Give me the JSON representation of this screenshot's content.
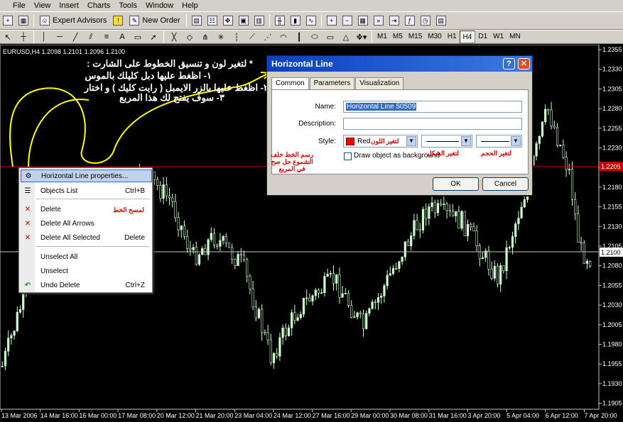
{
  "menu": [
    "File",
    "View",
    "Insert",
    "Charts",
    "Tools",
    "Window",
    "Help"
  ],
  "toolbar": {
    "expert_advisors": "Expert Advisors",
    "new_order": "New Order",
    "timeframes": [
      "M1",
      "M5",
      "M15",
      "M30",
      "H1",
      "H4",
      "D1",
      "W1",
      "MN"
    ],
    "active_timeframe": "H4"
  },
  "chart": {
    "symbol_info": "EURUSD,H4  1.2098 1.2101 1.2096 1.2100",
    "price_labels": [
      "1.2355",
      "1.2330",
      "1.2305",
      "1.2280",
      "1.2255",
      "1.2230",
      "1.2205",
      "1.2180",
      "1.2155",
      "1.2130",
      "1.2105",
      "1.2080",
      "1.2055",
      "1.2030",
      "1.2005",
      "1.1980",
      "1.1955",
      "1.1930",
      "1.1905"
    ],
    "time_labels": [
      "13 Mar 2006",
      "14 Mar 16:00",
      "16 Mar 00:00",
      "17 Mar 08:00",
      "20 Mar 12:00",
      "21 Mar 20:00",
      "23 Mar 04:00",
      "24 Mar 12:00",
      "27 Mar 16:00",
      "29 Mar 00:00",
      "30 Mar 08:00",
      "31 Mar 16:00",
      "3 Apr 20:00",
      "5 Apr 04:00",
      "6 Apr 12:00",
      "7 Apr 20:00"
    ],
    "hline_price": "1.2205",
    "current_price": "1.2100",
    "colors": {
      "hline": "#cc0000",
      "candle": "#ccffcc",
      "grid": "#c8c8c8",
      "price_box": "#cc0000"
    }
  },
  "instructions": [
    "* لتغير لون و تنسيق الخطوط على الشارت :",
    "١- اظغط عليها دبل كليلك بالموس",
    "٢- اظغط عليها بالزر الايمبل ( رايت كليك ) و اختار",
    "٣- سوف يفتح لك هذا المربع"
  ],
  "context_menu": {
    "items": [
      {
        "label": "Horizontal Line properties...",
        "shortcut": "",
        "icon": "properties-icon"
      },
      {
        "label": "Objects List",
        "shortcut": "Ctrl+B",
        "icon": "objects-list-icon"
      },
      {
        "label": "Delete",
        "shortcut": "",
        "icon": "delete-icon"
      },
      {
        "label": "Delete All Arrows",
        "shortcut": "",
        "icon": "delete-arrows-icon"
      },
      {
        "label": "Delete All Selected",
        "shortcut": "Delete",
        "icon": "delete-selected-icon"
      },
      {
        "label": "Unselect All",
        "shortcut": "",
        "icon": ""
      },
      {
        "label": "Unselect",
        "shortcut": "",
        "icon": ""
      },
      {
        "label": "Undo Delete",
        "shortcut": "Ctrl+Z",
        "icon": "undo-icon"
      }
    ],
    "delete_note": "لمسح الخط"
  },
  "dialog": {
    "title": "Horizontal Line",
    "tabs": [
      "Common",
      "Parameters",
      "Visualization"
    ],
    "active_tab": "Common",
    "name_label": "Name:",
    "name_value": "Horizontal Line 50509",
    "description_label": "Description:",
    "description_value": "",
    "style_label": "Style:",
    "color_value": "Red",
    "color_hex": "#ff0000",
    "background_label": "Draw object as background",
    "ok_label": "OK",
    "cancel_label": "Cancel",
    "color_note": "لتغير اللون",
    "shape_note": "لتغير الشكل",
    "size_note": "لتغير الحجم",
    "background_note": [
      "رسم الخط خلف",
      "الشموع حل صح",
      "في المربع"
    ]
  }
}
